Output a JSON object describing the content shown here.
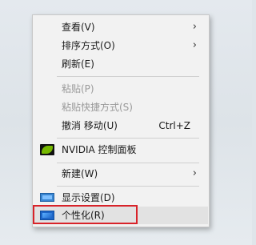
{
  "context_menu": {
    "items": [
      {
        "label": "查看(V)",
        "submenu": true,
        "disabled": false
      },
      {
        "label": "排序方式(O)",
        "submenu": true,
        "disabled": false
      },
      {
        "label": "刷新(E)",
        "disabled": false
      },
      {
        "label": "粘贴(P)",
        "disabled": true
      },
      {
        "label": "粘贴快捷方式(S)",
        "disabled": true
      },
      {
        "label": "撤消 移动(U)",
        "accel": "Ctrl+Z",
        "disabled": false
      },
      {
        "label": "NVIDIA 控制面板",
        "icon": "nvidia-icon",
        "disabled": false
      },
      {
        "label": "新建(W)",
        "submenu": true,
        "disabled": false
      },
      {
        "label": "显示设置(D)",
        "icon": "display-settings-icon",
        "disabled": false
      },
      {
        "label": "个性化(R)",
        "icon": "personalize-icon",
        "disabled": false,
        "hovered": true,
        "highlighted": true
      }
    ],
    "submenu_arrow": "›"
  },
  "colors": {
    "menu_bg": "#f2f2f2",
    "hover_bg": "#e2e2e2",
    "highlight_border": "#d8232a",
    "disabled_text": "#9a9a9a"
  }
}
